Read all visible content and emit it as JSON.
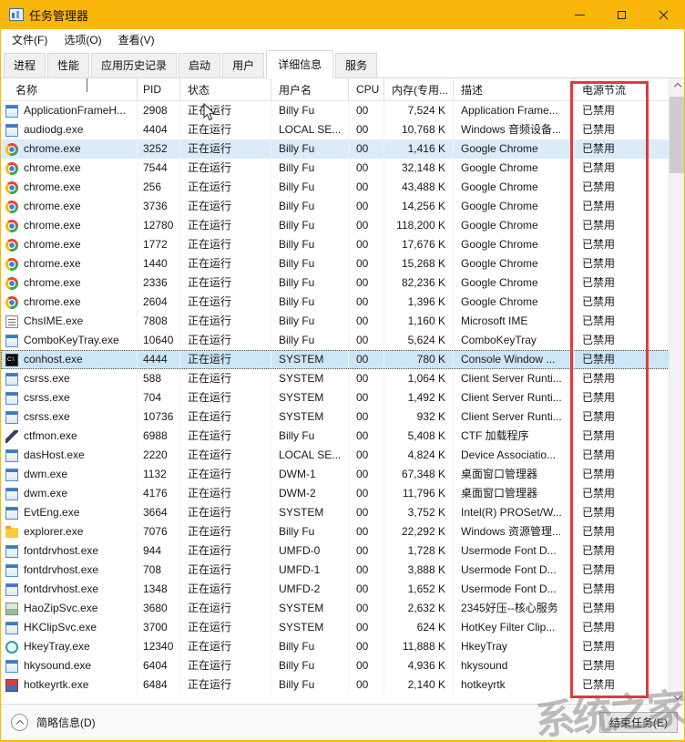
{
  "window": {
    "title": "任务管理器"
  },
  "menu": {
    "items": [
      {
        "name": "menu-file",
        "label": "文件(F)"
      },
      {
        "name": "menu-options",
        "label": "选项(O)"
      },
      {
        "name": "menu-view",
        "label": "查看(V)"
      }
    ]
  },
  "tabs": {
    "selected": "详细信息",
    "items": [
      {
        "name": "tab-processes",
        "label": "进程"
      },
      {
        "name": "tab-performance",
        "label": "性能"
      },
      {
        "name": "tab-app-history",
        "label": "应用历史记录"
      },
      {
        "name": "tab-startup",
        "label": "启动"
      },
      {
        "name": "tab-users",
        "label": "用户"
      },
      {
        "name": "tab-details",
        "label": "详细信息",
        "selected": true
      },
      {
        "name": "tab-services",
        "label": "服务"
      }
    ]
  },
  "table": {
    "columns": [
      {
        "key": "name",
        "label": "名称",
        "sorted": "asc"
      },
      {
        "key": "pid",
        "label": "PID"
      },
      {
        "key": "status",
        "label": "状态"
      },
      {
        "key": "user",
        "label": "用户名"
      },
      {
        "key": "cpu",
        "label": "CPU"
      },
      {
        "key": "mem",
        "label": "内存(专用..."
      },
      {
        "key": "desc",
        "label": "描述"
      },
      {
        "key": "power",
        "label": "电源节流"
      }
    ],
    "rows": [
      {
        "icon": "app-window-icon",
        "name": "ApplicationFrameH...",
        "pid": "2908",
        "status": "正在运行",
        "user": "Billy Fu",
        "cpu": "00",
        "mem": "7,524 K",
        "desc": "Application Frame...",
        "power": "已禁用",
        "state": ""
      },
      {
        "icon": "app-window-icon",
        "name": "audiodg.exe",
        "pid": "4404",
        "status": "正在运行",
        "user": "LOCAL SE...",
        "cpu": "00",
        "mem": "10,768 K",
        "desc": "Windows 音频设备...",
        "power": "已禁用",
        "state": ""
      },
      {
        "icon": "chrome-icon",
        "name": "chrome.exe",
        "pid": "3252",
        "status": "正在运行",
        "user": "Billy Fu",
        "cpu": "00",
        "mem": "1,416 K",
        "desc": "Google Chrome",
        "power": "已禁用",
        "state": "hover"
      },
      {
        "icon": "chrome-icon",
        "name": "chrome.exe",
        "pid": "7544",
        "status": "正在运行",
        "user": "Billy Fu",
        "cpu": "00",
        "mem": "32,148 K",
        "desc": "Google Chrome",
        "power": "已禁用",
        "state": ""
      },
      {
        "icon": "chrome-icon",
        "name": "chrome.exe",
        "pid": "256",
        "status": "正在运行",
        "user": "Billy Fu",
        "cpu": "00",
        "mem": "43,488 K",
        "desc": "Google Chrome",
        "power": "已禁用",
        "state": ""
      },
      {
        "icon": "chrome-icon",
        "name": "chrome.exe",
        "pid": "3736",
        "status": "正在运行",
        "user": "Billy Fu",
        "cpu": "00",
        "mem": "14,256 K",
        "desc": "Google Chrome",
        "power": "已禁用",
        "state": ""
      },
      {
        "icon": "chrome-icon",
        "name": "chrome.exe",
        "pid": "12780",
        "status": "正在运行",
        "user": "Billy Fu",
        "cpu": "00",
        "mem": "118,200 K",
        "desc": "Google Chrome",
        "power": "已禁用",
        "state": ""
      },
      {
        "icon": "chrome-icon",
        "name": "chrome.exe",
        "pid": "1772",
        "status": "正在运行",
        "user": "Billy Fu",
        "cpu": "00",
        "mem": "17,676 K",
        "desc": "Google Chrome",
        "power": "已禁用",
        "state": ""
      },
      {
        "icon": "chrome-icon",
        "name": "chrome.exe",
        "pid": "1440",
        "status": "正在运行",
        "user": "Billy Fu",
        "cpu": "00",
        "mem": "15,268 K",
        "desc": "Google Chrome",
        "power": "已禁用",
        "state": ""
      },
      {
        "icon": "chrome-icon",
        "name": "chrome.exe",
        "pid": "2336",
        "status": "正在运行",
        "user": "Billy Fu",
        "cpu": "00",
        "mem": "82,236 K",
        "desc": "Google Chrome",
        "power": "已禁用",
        "state": ""
      },
      {
        "icon": "chrome-icon",
        "name": "chrome.exe",
        "pid": "2604",
        "status": "正在运行",
        "user": "Billy Fu",
        "cpu": "00",
        "mem": "1,396 K",
        "desc": "Google Chrome",
        "power": "已禁用",
        "state": ""
      },
      {
        "icon": "ime-icon",
        "name": "ChsIME.exe",
        "pid": "7808",
        "status": "正在运行",
        "user": "Billy Fu",
        "cpu": "00",
        "mem": "1,160 K",
        "desc": "Microsoft IME",
        "power": "已禁用",
        "state": ""
      },
      {
        "icon": "app-window-icon",
        "name": "ComboKeyTray.exe",
        "pid": "10640",
        "status": "正在运行",
        "user": "Billy Fu",
        "cpu": "00",
        "mem": "5,624 K",
        "desc": "ComboKeyTray",
        "power": "已禁用",
        "state": ""
      },
      {
        "icon": "console-icon",
        "name": "conhost.exe",
        "pid": "4444",
        "status": "正在运行",
        "user": "SYSTEM",
        "cpu": "00",
        "mem": "780 K",
        "desc": "Console Window ...",
        "power": "已禁用",
        "state": "selected"
      },
      {
        "icon": "app-window-icon",
        "name": "csrss.exe",
        "pid": "588",
        "status": "正在运行",
        "user": "SYSTEM",
        "cpu": "00",
        "mem": "1,064 K",
        "desc": "Client Server Runti...",
        "power": "已禁用",
        "state": ""
      },
      {
        "icon": "app-window-icon",
        "name": "csrss.exe",
        "pid": "704",
        "status": "正在运行",
        "user": "SYSTEM",
        "cpu": "00",
        "mem": "1,492 K",
        "desc": "Client Server Runti...",
        "power": "已禁用",
        "state": ""
      },
      {
        "icon": "app-window-icon",
        "name": "csrss.exe",
        "pid": "10736",
        "status": "正在运行",
        "user": "SYSTEM",
        "cpu": "00",
        "mem": "932 K",
        "desc": "Client Server Runti...",
        "power": "已禁用",
        "state": ""
      },
      {
        "icon": "pen-icon",
        "name": "ctfmon.exe",
        "pid": "6988",
        "status": "正在运行",
        "user": "Billy Fu",
        "cpu": "00",
        "mem": "5,408 K",
        "desc": "CTF 加载程序",
        "power": "已禁用",
        "state": ""
      },
      {
        "icon": "app-window-icon",
        "name": "dasHost.exe",
        "pid": "2220",
        "status": "正在运行",
        "user": "LOCAL SE...",
        "cpu": "00",
        "mem": "4,824 K",
        "desc": "Device Associatio...",
        "power": "已禁用",
        "state": ""
      },
      {
        "icon": "app-window-icon",
        "name": "dwm.exe",
        "pid": "1132",
        "status": "正在运行",
        "user": "DWM-1",
        "cpu": "00",
        "mem": "67,348 K",
        "desc": "桌面窗口管理器",
        "power": "已禁用",
        "state": ""
      },
      {
        "icon": "app-window-icon",
        "name": "dwm.exe",
        "pid": "4176",
        "status": "正在运行",
        "user": "DWM-2",
        "cpu": "00",
        "mem": "11,796 K",
        "desc": "桌面窗口管理器",
        "power": "已禁用",
        "state": ""
      },
      {
        "icon": "app-window-icon",
        "name": "EvtEng.exe",
        "pid": "3664",
        "status": "正在运行",
        "user": "SYSTEM",
        "cpu": "00",
        "mem": "3,752 K",
        "desc": "Intel(R) PROSet/W...",
        "power": "已禁用",
        "state": ""
      },
      {
        "icon": "folder-icon",
        "name": "explorer.exe",
        "pid": "7076",
        "status": "正在运行",
        "user": "Billy Fu",
        "cpu": "00",
        "mem": "22,292 K",
        "desc": "Windows 资源管理...",
        "power": "已禁用",
        "state": ""
      },
      {
        "icon": "app-window-icon",
        "name": "fontdrvhost.exe",
        "pid": "944",
        "status": "正在运行",
        "user": "UMFD-0",
        "cpu": "00",
        "mem": "1,728 K",
        "desc": "Usermode Font D...",
        "power": "已禁用",
        "state": ""
      },
      {
        "icon": "app-window-icon",
        "name": "fontdrvhost.exe",
        "pid": "708",
        "status": "正在运行",
        "user": "UMFD-1",
        "cpu": "00",
        "mem": "3,888 K",
        "desc": "Usermode Font D...",
        "power": "已禁用",
        "state": ""
      },
      {
        "icon": "app-window-icon",
        "name": "fontdrvhost.exe",
        "pid": "1348",
        "status": "正在运行",
        "user": "UMFD-2",
        "cpu": "00",
        "mem": "1,652 K",
        "desc": "Usermode Font D...",
        "power": "已禁用",
        "state": ""
      },
      {
        "icon": "haozip-icon",
        "name": "HaoZipSvc.exe",
        "pid": "3680",
        "status": "正在运行",
        "user": "SYSTEM",
        "cpu": "00",
        "mem": "2,632 K",
        "desc": "2345好压--核心服务",
        "power": "已禁用",
        "state": ""
      },
      {
        "icon": "app-window-icon",
        "name": "HKClipSvc.exe",
        "pid": "3700",
        "status": "正在运行",
        "user": "SYSTEM",
        "cpu": "00",
        "mem": "624 K",
        "desc": "HotKey Filter Clip...",
        "power": "已禁用",
        "state": ""
      },
      {
        "icon": "hkeytray-icon",
        "name": "HkeyTray.exe",
        "pid": "12340",
        "status": "正在运行",
        "user": "Billy Fu",
        "cpu": "00",
        "mem": "11,888 K",
        "desc": "HkeyTray",
        "power": "已禁用",
        "state": ""
      },
      {
        "icon": "app-window-icon",
        "name": "hkysound.exe",
        "pid": "6404",
        "status": "正在运行",
        "user": "Billy Fu",
        "cpu": "00",
        "mem": "4,936 K",
        "desc": "hkysound",
        "power": "已禁用",
        "state": ""
      },
      {
        "icon": "hotkeyrtk-icon",
        "name": "hotkeyrtk.exe",
        "pid": "6484",
        "status": "正在运行",
        "user": "Billy Fu",
        "cpu": "00",
        "mem": "2,140 K",
        "desc": "hotkeyrtk",
        "power": "已禁用",
        "state": ""
      }
    ]
  },
  "statusbar": {
    "brief_label": "简略信息(D)",
    "end_task_label": "结束任务(E)"
  },
  "annotation": {
    "watermark_text": "系统之家",
    "highlight_color": "#E03A3C"
  },
  "colors": {
    "titlebar": "#FBB60C",
    "selection": "#CDE6F7",
    "hover": "#DCEBFA"
  }
}
